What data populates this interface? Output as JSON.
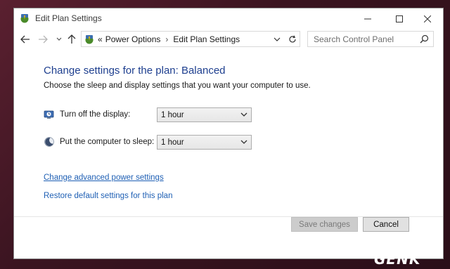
{
  "window": {
    "title": "Edit Plan Settings"
  },
  "navbar": {
    "breadcrumb_prefix": "«",
    "breadcrumb": [
      "Power Options",
      "Edit Plan Settings"
    ],
    "breadcrumb_separator": "›",
    "search_placeholder": "Search Control Panel"
  },
  "main": {
    "heading": "Change settings for the plan: Balanced",
    "description": "Choose the sleep and display settings that you want your computer to use.",
    "settings": [
      {
        "label": "Turn off the display:",
        "value": "1 hour",
        "icon": "monitor-clock-icon"
      },
      {
        "label": "Put the computer to sleep:",
        "value": "1 hour",
        "icon": "moon-icon"
      }
    ],
    "links": {
      "advanced": "Change advanced power settings",
      "restore": "Restore default settings for this plan"
    }
  },
  "footer": {
    "save_label": "Save changes",
    "cancel_label": "Cancel"
  },
  "watermark": "GENK",
  "colors": {
    "heading": "#1e3f8f",
    "link": "#1e5fb4",
    "desktop": "#3a1420"
  }
}
